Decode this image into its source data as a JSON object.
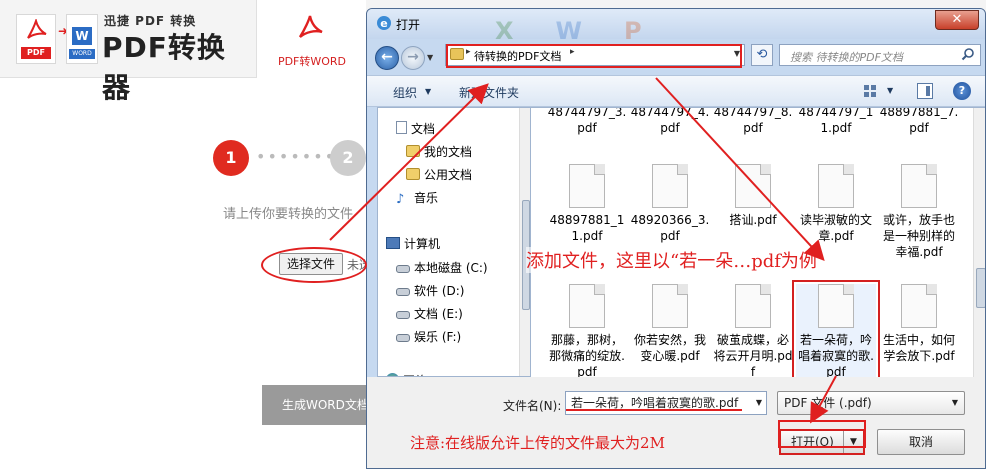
{
  "app": {
    "brand": "迅捷 PDF 转换",
    "product": "PDF转换器",
    "logo_pdf_tag": "PDF",
    "logo_word_tag": "WORD",
    "nav_tab_label": "PDF转WORD",
    "step1": "1",
    "step2": "2",
    "step_dots": "•••••••",
    "upload_hint": "请上传你要转换的文件",
    "choose_button": "选择文件",
    "choose_status": "未选",
    "generate_button": "生成WORD文档",
    "brand_color": "#e02020"
  },
  "dialog": {
    "title": "打开",
    "close": "✕",
    "address": {
      "path": "待转换的PDF文档",
      "search_placeholder": "搜索 待转换的PDF文档"
    },
    "toolbar": {
      "organize": "组织",
      "new_folder": "新建文件夹"
    },
    "nav_pane": {
      "items": [
        {
          "label": "文档",
          "icon": "document-icon"
        },
        {
          "label": "我的文档",
          "icon": "folder-icon"
        },
        {
          "label": "公用文档",
          "icon": "folder-icon"
        },
        {
          "label": "音乐",
          "icon": "music-icon"
        },
        {
          "label": "计算机",
          "icon": "computer-icon"
        },
        {
          "label": "本地磁盘 (C:)",
          "icon": "drive-icon"
        },
        {
          "label": "软件 (D:)",
          "icon": "drive-icon"
        },
        {
          "label": "文档 (E:)",
          "icon": "drive-icon"
        },
        {
          "label": "娱乐 (F:)",
          "icon": "drive-icon"
        },
        {
          "label": "网络",
          "icon": "network-icon"
        }
      ]
    },
    "files": [
      {
        "name": "48744797_3.pdf"
      },
      {
        "name": "48744797_4.pdf"
      },
      {
        "name": "48744797_8.pdf"
      },
      {
        "name": "48744797_11.pdf"
      },
      {
        "name": "48897881_7.pdf"
      },
      {
        "name": "48897881_11.pdf"
      },
      {
        "name": "48920366_3.pdf"
      },
      {
        "name": "搭讪.pdf"
      },
      {
        "name": "读毕淑敏的文章.pdf"
      },
      {
        "name": "或许，放手也是一种别样的幸福.pdf"
      },
      {
        "name": "那藤，那树，那微痛的绽放.pdf"
      },
      {
        "name": "你若安然，我变心暖.pdf"
      },
      {
        "name": "破茧成蝶，必将云开月明.pdf"
      },
      {
        "name": "若一朵荷，吟唱着寂寞的歌.pdf"
      },
      {
        "name": "生活中，如何学会放下.pdf"
      }
    ],
    "bottom": {
      "filename_label": "文件名(N):",
      "filename_value": "若一朵荷，吟唱着寂寞的歌.pdf",
      "filetype": "PDF 文件 (.pdf)",
      "open_button": "打开(O)",
      "cancel_button": "取消"
    }
  },
  "annotations": {
    "main": "添加文件，这里以“若一朵…pdf为例",
    "note": "注意:在线版允许上传的文件最大为2M"
  }
}
